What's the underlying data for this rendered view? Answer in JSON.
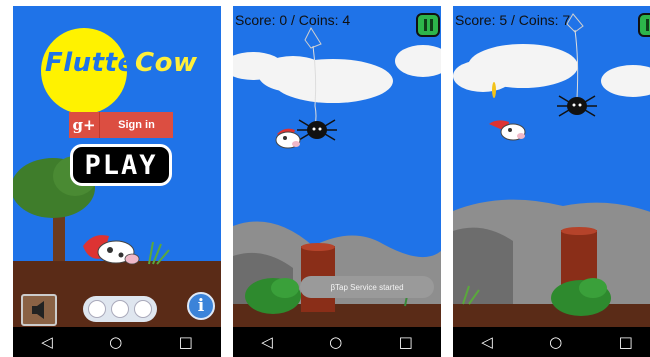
{
  "screens": [
    {
      "title_part1": "Flutter",
      "title_part2": "Cow",
      "signin_icon": "g+",
      "signin_label": "Sign in",
      "play_label": "PLAY",
      "info_label": "i"
    },
    {
      "score_text": "Score: 0 / Coins: 4",
      "toast": "βTap Service started"
    },
    {
      "score_text": "Score: 5 / Coins: 7"
    }
  ],
  "navigation": {
    "back": "◁",
    "home": "○",
    "recents": "□"
  },
  "colors": {
    "sky": "#1f73e8",
    "ground": "#5a2b17",
    "sun": "#fff200",
    "google_red": "#dc4e41",
    "pause_green": "#2db54b"
  }
}
